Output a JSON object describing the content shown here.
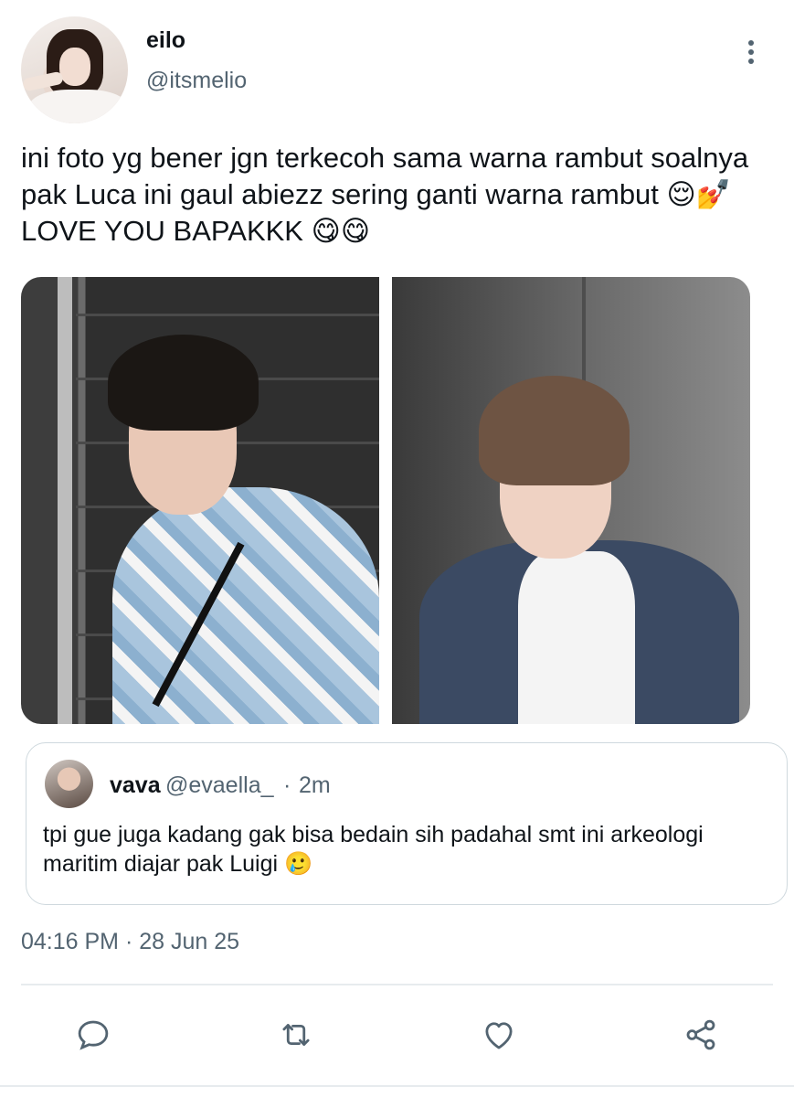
{
  "author": {
    "name": "eilo",
    "handle": "@itsmelio"
  },
  "tweet": {
    "text": "ini foto yg bener jgn terkecoh sama warna rambut soalnya pak Luca ini gaul abiezz sering ganti warna rambut 😌💅 LOVE YOU BAPAKKK 😋😋"
  },
  "quoted": {
    "name": "vava",
    "handle": "@evaella_",
    "separator": "·",
    "time": "2m",
    "text": "tpi gue juga kadang gak bisa bedain sih padahal smt ini arkeologi maritim diajar pak Luigi 🥲"
  },
  "meta": {
    "timestamp": "04:16 PM · 28 Jun 25"
  },
  "icons": {
    "more": "more-vertical-icon",
    "reply": "reply-icon",
    "retweet": "retweet-icon",
    "like": "heart-icon",
    "share": "share-icon"
  },
  "colors": {
    "text": "#0f1419",
    "secondary": "#536471",
    "border": "#cfd9de"
  }
}
